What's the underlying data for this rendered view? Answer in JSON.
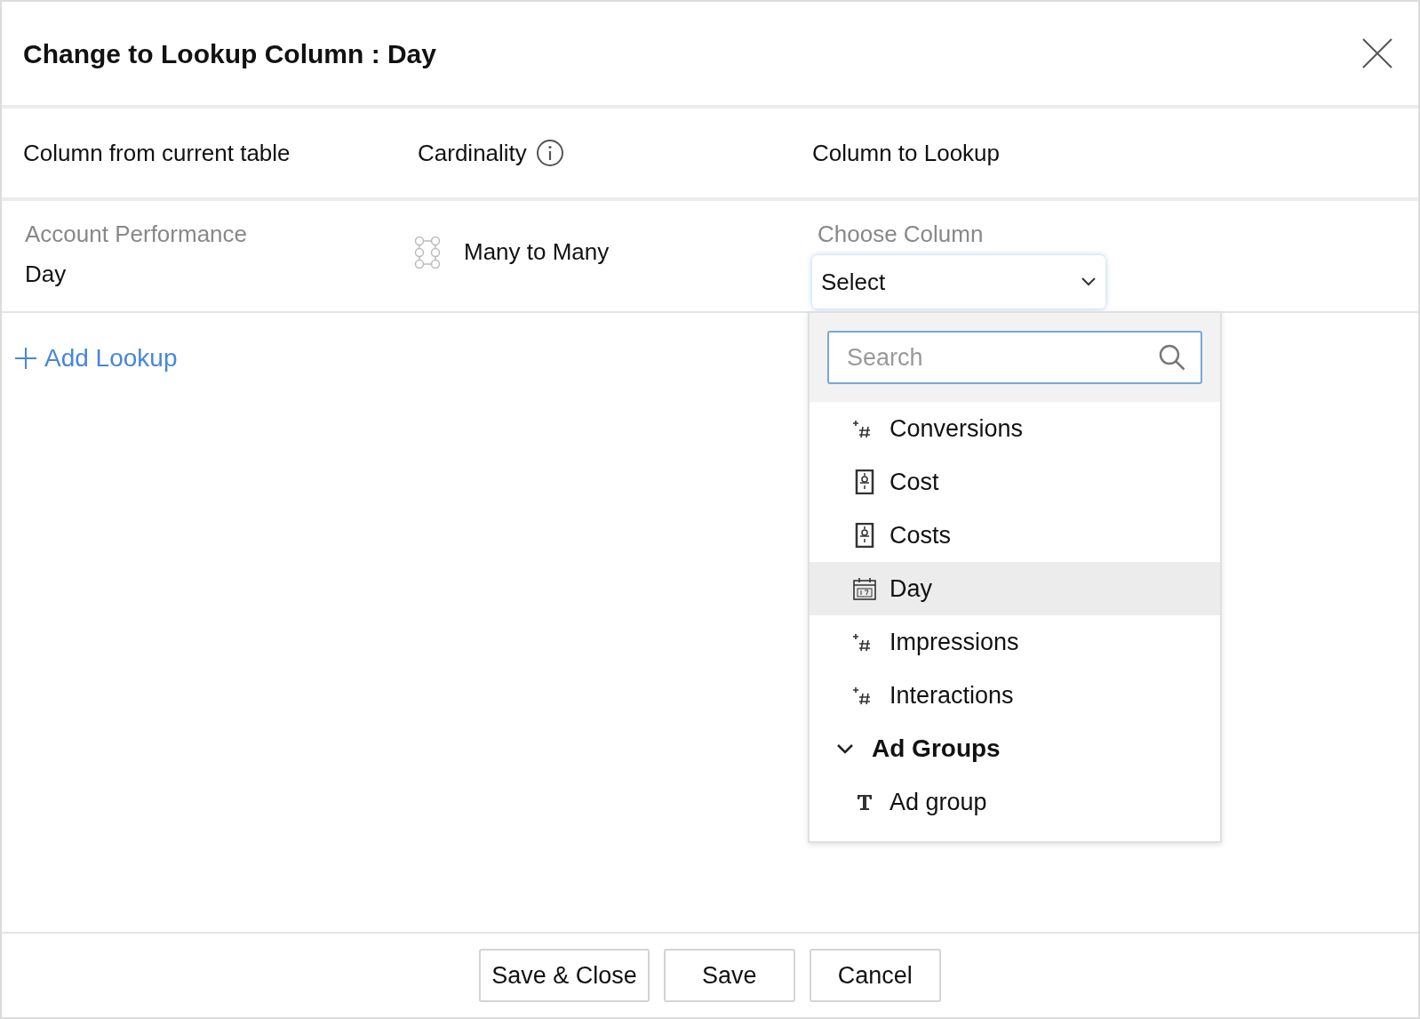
{
  "dialog": {
    "title": "Change to Lookup Column : Day"
  },
  "columns": [
    "Column from current table",
    "Cardinality",
    "Column to Lookup"
  ],
  "row": {
    "table": "Account Performance",
    "column": "Day",
    "cardinality": "Many to Many",
    "lookup_label": "Choose Column",
    "select_value": "Select"
  },
  "add_lookup": "Add Lookup",
  "dropdown": {
    "search_placeholder": "Search",
    "items": [
      {
        "kind": "number",
        "label": "Conversions",
        "selected": false
      },
      {
        "kind": "currency",
        "label": "Cost",
        "selected": false
      },
      {
        "kind": "currency",
        "label": "Costs",
        "selected": false
      },
      {
        "kind": "date",
        "label": "Day",
        "selected": true
      },
      {
        "kind": "number",
        "label": "Impressions",
        "selected": false
      },
      {
        "kind": "number",
        "label": "Interactions",
        "selected": false
      },
      {
        "kind": "group",
        "label": "Ad Groups",
        "expanded": true
      },
      {
        "kind": "text",
        "label": "Ad group",
        "selected": false
      }
    ]
  },
  "buttons": [
    "Save & Close",
    "Save",
    "Cancel"
  ]
}
